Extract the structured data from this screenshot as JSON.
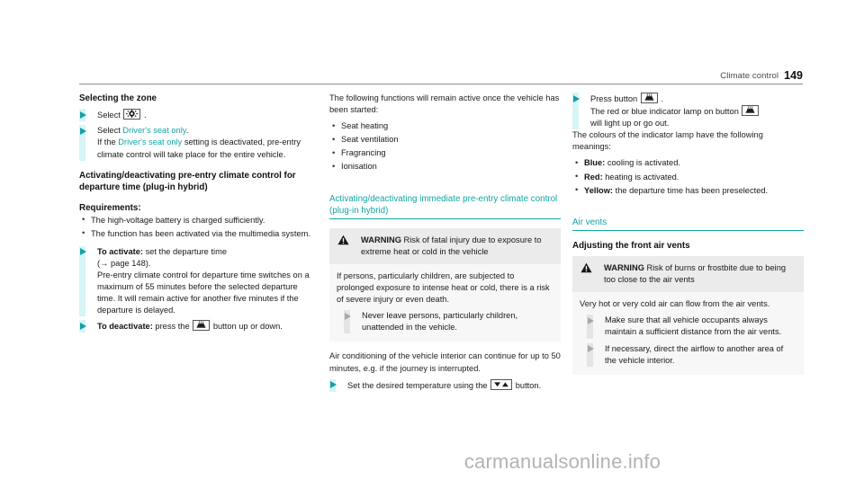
{
  "header": {
    "title": "Climate control",
    "page_number": "149"
  },
  "colors": {
    "accent_teal": "#12a5a5",
    "arrow_teal": "#12a0a8",
    "arrow_bar": "#d6f5f6",
    "warning_header_bg": "#ebebeb",
    "warning_body_bg": "#f7f7f7",
    "watermark": "#b3b3b3"
  },
  "column1": {
    "heading_selecting_zone": "Selecting the zone",
    "step_select_label": "Select",
    "step_select_icon": "fan-zone-icon",
    "step_select_period": ".",
    "step_driver_seat_prefix": "Select ",
    "step_driver_seat_link": "Driver's seat only",
    "step_driver_seat_period": ".",
    "step_driver_seat_note_a": "If the ",
    "step_driver_seat_note_link": "Driver's seat only",
    "step_driver_seat_note_b": " setting is deactivated, pre-entry climate control will take place for the entire vehicle.",
    "heading_activating_departure": "Activating/deactivating pre-entry climate control for departure time (plug-in hybrid)",
    "requirements_label": "Requirements:",
    "requirements": [
      "The high-voltage battery is charged sufficiently.",
      "The function has been activated via the multimedia system."
    ],
    "to_activate_label": "To activate:",
    "to_activate_text": " set the departure time",
    "to_activate_ref": "(→ page 148).",
    "to_activate_note": "Pre-entry climate control for departure time switches on a maximum of 55 minutes before the selected departure time. It will remain active for another five minutes if the departure is delayed.",
    "to_deactivate_label": "To deactivate:",
    "to_deactivate_text_a": " press the ",
    "to_deactivate_icon": "preentry-climate-button-icon",
    "to_deactivate_text_b": " button up or down."
  },
  "column2": {
    "intro": "The following functions will remain active once the vehicle has been started:",
    "functions": [
      "Seat heating",
      "Seat ventilation",
      "Fragrancing",
      "Ionisation"
    ],
    "section_heading": "Activating/deactivating immediate pre-entry climate control (plug-in hybrid)",
    "warning": {
      "icon": "warning-triangle-icon",
      "label": "WARNING",
      "title": " Risk of fatal injury due to exposure to extreme heat or cold in the vehicle",
      "body": "If persons, particularly children, are subjected to prolonged exposure to intense heat or cold, there is a risk of severe injury or even death.",
      "action": "Never leave persons, particularly children, unattended in the vehicle."
    },
    "after_warning": "Air conditioning of the vehicle interior can continue for up to 50 minutes, e.g. if the journey is interrupted.",
    "set_temp_text_a": "Set the desired temperature using the ",
    "set_temp_icon": "down-up-arrows-button-icon",
    "set_temp_text_b": " button."
  },
  "column3": {
    "press_button_text_a": "Press button ",
    "press_button_icon": "preentry-climate-button-icon",
    "press_button_text_b": " .",
    "press_button_note_a": "The red or blue indicator lamp on button ",
    "press_button_note_icon": "preentry-climate-button-icon",
    "press_button_note_b": " will light up or go out.",
    "colours_intro": "The colours of the indicator lamp have the following meanings:",
    "colour_meanings": [
      {
        "label": "Blue:",
        "text": " cooling is activated."
      },
      {
        "label": "Red:",
        "text": " heating is activated."
      },
      {
        "label": "Yellow:",
        "text": " the departure time has been preselected."
      }
    ],
    "section_heading": "Air vents",
    "sub_heading": "Adjusting the front air vents",
    "warning": {
      "icon": "warning-triangle-icon",
      "label": "WARNING",
      "title": " Risk of burns or frostbite due to being too close to the air vents",
      "body": "Very hot or very cold air can flow from the air vents.",
      "actions": [
        "Make sure that all vehicle occupants always maintain a sufficient distance from the air vents.",
        "If necessary, direct the airflow to another area of the vehicle interior."
      ]
    }
  },
  "watermark": {
    "text": "carmanualsonline.info"
  }
}
